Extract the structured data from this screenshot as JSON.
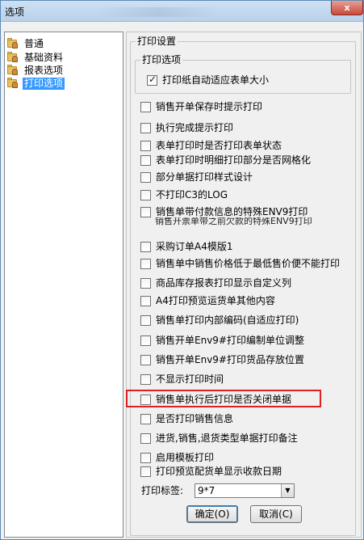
{
  "window": {
    "title": "选项",
    "close_label": "x"
  },
  "tree": {
    "items": [
      {
        "label": "普通",
        "selected": false
      },
      {
        "label": "基础资料",
        "selected": false
      },
      {
        "label": "报表选项",
        "selected": false
      },
      {
        "label": "打印选项",
        "selected": true
      }
    ]
  },
  "panel": {
    "group_title": "打印设置",
    "sub_group_title": "打印选项",
    "auto_fit": {
      "label": "打印纸自动适应表单大小",
      "checked": true
    },
    "options": [
      {
        "label": "销售开单保存时提示打印",
        "checked": false
      },
      {
        "label": "执行完成提示打印",
        "checked": false
      },
      {
        "label": "表单打印时是否打印表单状态",
        "checked": false
      },
      {
        "label": "表单打印时明细打印部分是否网格化",
        "checked": false
      },
      {
        "label": "部分单据打印样式设计",
        "checked": false
      },
      {
        "label": "不打印C3的LOG",
        "checked": false
      },
      {
        "label": "销售单带付款信息的特殊ENV9打印",
        "checked": false
      },
      {
        "label": "采购订单A4模版1",
        "checked": false
      },
      {
        "label": "销售单中销售价格低于最低售价便不能打印",
        "checked": false
      },
      {
        "label": "商品库存报表打印显示自定义列",
        "checked": false
      },
      {
        "label": "A4打印预览运货单其他内容",
        "checked": false
      },
      {
        "label": "销售单打印内部编码(自适应打印)",
        "checked": false
      },
      {
        "label": "销售开单Env9#打印编制单位调整",
        "checked": false
      },
      {
        "label": "销售开单Env9#打印货品存放位置",
        "checked": false
      },
      {
        "label": "不显示打印时间",
        "checked": false
      },
      {
        "label": "销售单执行后打印是否关闭单据",
        "checked": false
      },
      {
        "label": "是否打印销售信息",
        "checked": false
      },
      {
        "label": "进货,销售,退货类型单据打印备注",
        "checked": false
      },
      {
        "label": "启用模板打印",
        "checked": false
      },
      {
        "label": "打印预览配货单显示收款日期",
        "checked": false
      }
    ],
    "overlap_text": "销售开票单带之前欠款的特殊ENV9打印",
    "print_tag_label": "打印标签:",
    "print_tag_value": "9*7",
    "ok_label": "确定(O)",
    "cancel_label": "取消(C)"
  },
  "colors": {
    "highlight": "#e02020",
    "selection": "#3399ff"
  }
}
